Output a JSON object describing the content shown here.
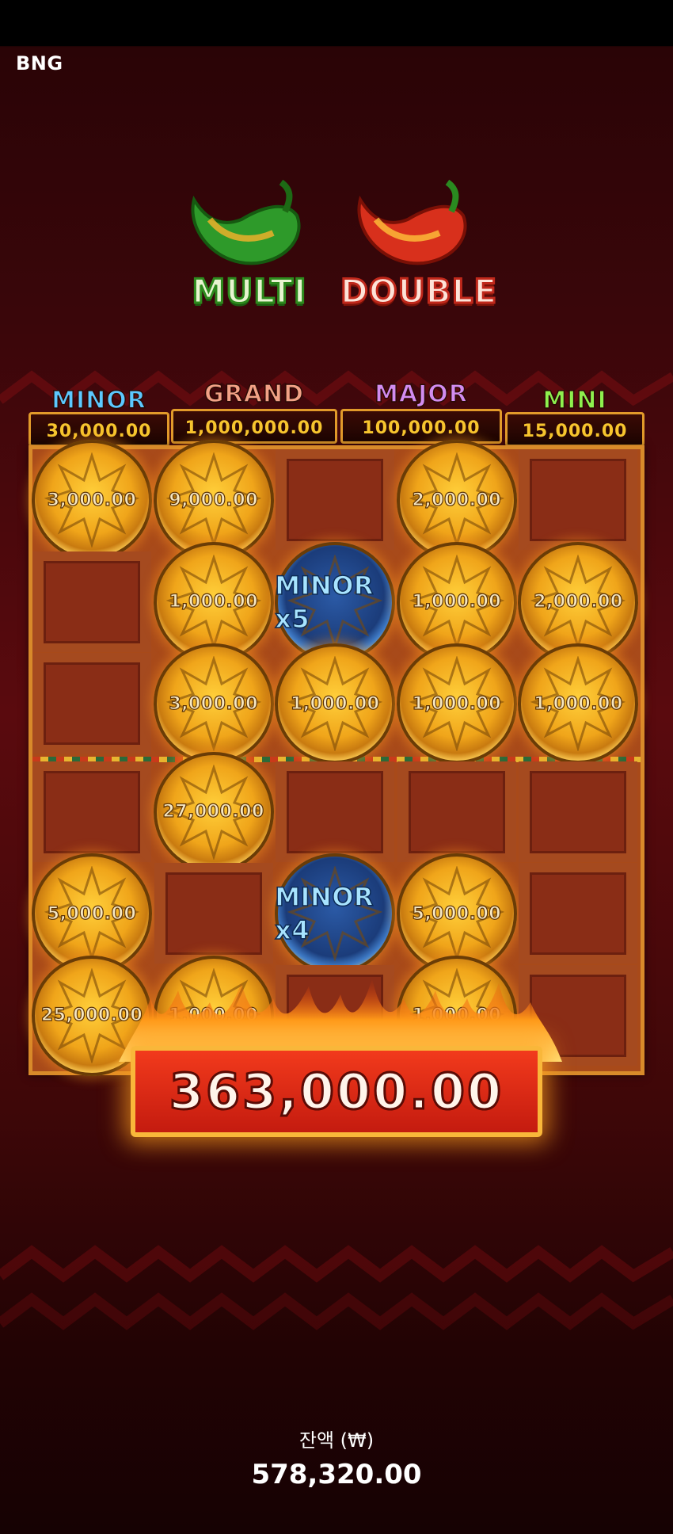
{
  "brand": "BNG",
  "features": {
    "multi": "MULTI",
    "double": "DOUBLE"
  },
  "jackpots": [
    {
      "name": "MINOR",
      "amount": "30,000.00",
      "color": "#5cc8ff"
    },
    {
      "name": "GRAND",
      "amount": "1,000,000.00",
      "color": "#f2a286"
    },
    {
      "name": "MAJOR",
      "amount": "100,000.00",
      "color": "#d28cf0"
    },
    {
      "name": "MINI",
      "amount": "15,000.00",
      "color": "#8ef04e"
    }
  ],
  "grid": [
    [
      "3,000.00",
      "9,000.00",
      "",
      "2,000.00",
      ""
    ],
    [
      "",
      "1,000.00",
      "MINOR x5",
      "1,000.00",
      "2,000.00"
    ],
    [
      "",
      "3,000.00",
      "1,000.00",
      "1,000.00",
      "1,000.00"
    ],
    [
      "",
      "27,000.00",
      "",
      "",
      ""
    ],
    [
      "5,000.00",
      "",
      "MINOR x4",
      "5,000.00",
      ""
    ],
    [
      "25,000.00",
      "1,000.00",
      "",
      "1,000.00",
      ""
    ]
  ],
  "win_amount": "363,000.00",
  "balance": {
    "label": "잔액 (₩)",
    "value": "578,320.00"
  }
}
